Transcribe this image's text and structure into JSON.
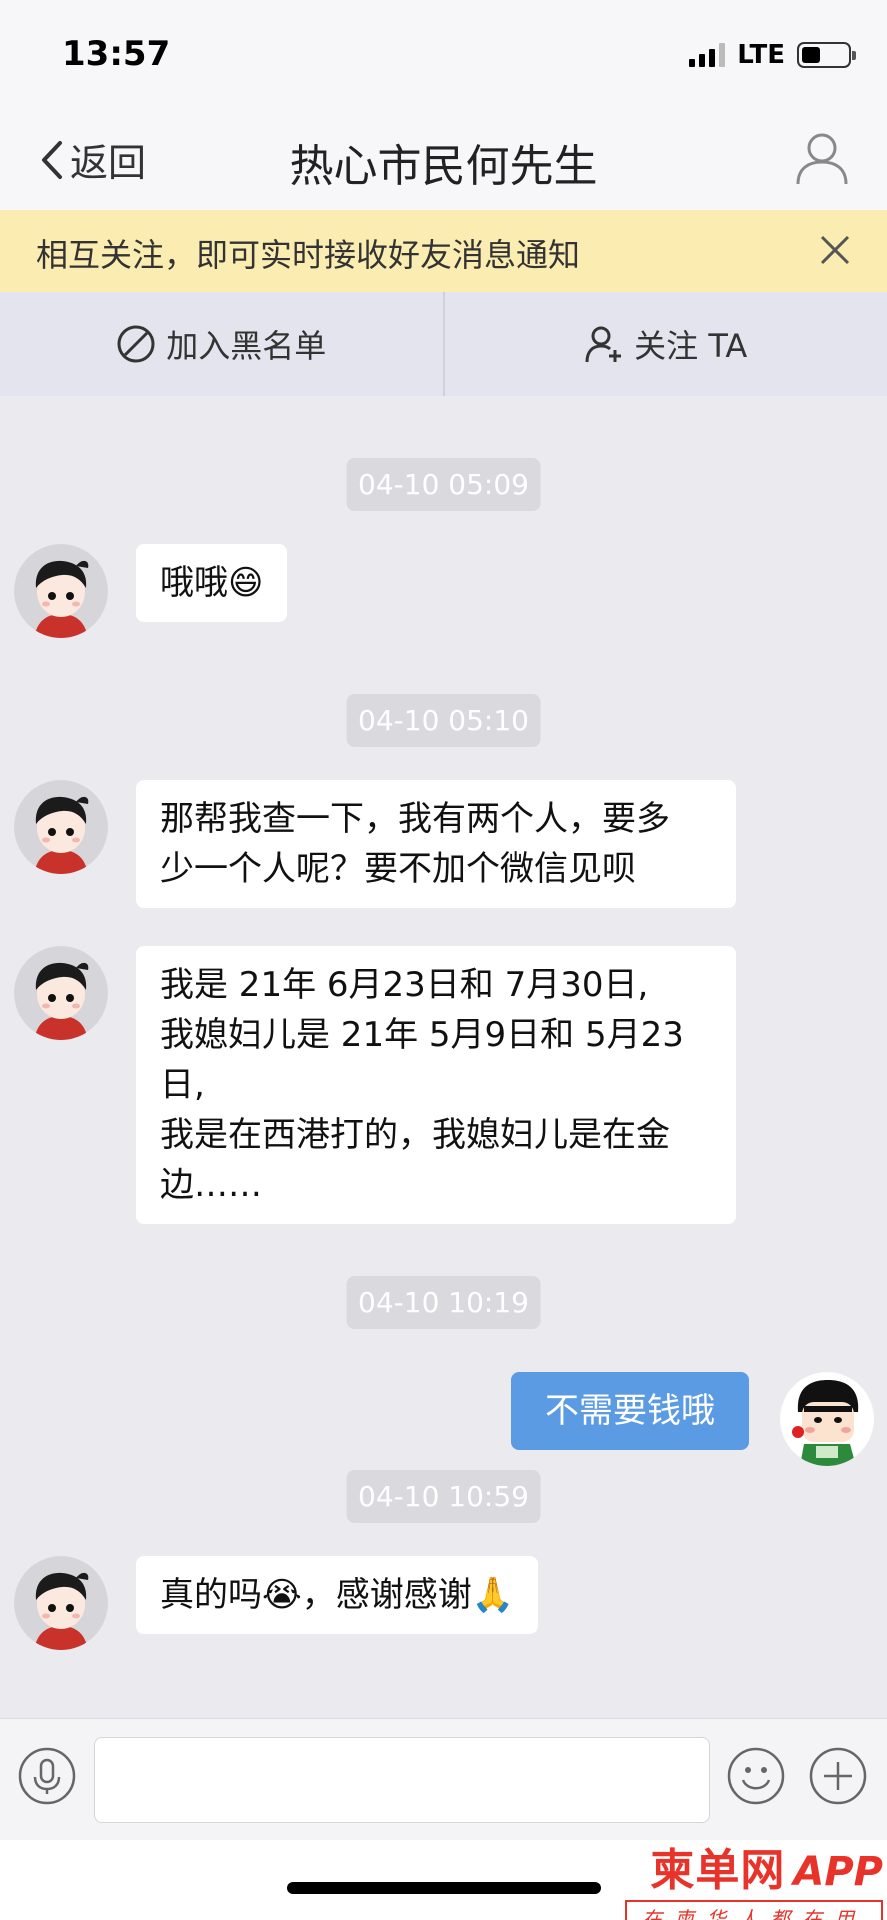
{
  "status_bar": {
    "time": "13:57",
    "network": "LTE"
  },
  "nav": {
    "back_label": "返回",
    "title": "热心市民何先生"
  },
  "notice": {
    "text": "相互关注，即可实时接收好友消息通知"
  },
  "actions": {
    "blacklist_label": "加入黑名单",
    "follow_label": "关注 TA"
  },
  "messages": {
    "ts1": "04-10 05:09",
    "m1": "哦哦😄",
    "ts2": "04-10 05:10",
    "m2_line1": "那帮我查一下，我有两个人，要多",
    "m2_line2": "少一个人呢？要不加个微信见呗",
    "m3_line1": "我是 21年 6月23日和 7月30日,",
    "m3_line2": "我媳妇儿是 21年 5月9日和 5月23",
    "m3_line3": "日,",
    "m3_line4": "我是在西港打的，我媳妇儿是在金",
    "m3_line5": "边……",
    "ts3": "04-10 10:19",
    "m4": "不需要钱哦",
    "ts4": "04-10 10:59",
    "m5": "真的吗😭，感谢感谢🙏"
  },
  "watermark": {
    "brand": "柬单网",
    "app": "APP",
    "slogan": "在柬华人都在用"
  },
  "colors": {
    "self_bubble": "#5b9be4",
    "notice_bg": "#fbedb1",
    "watermark_red": "#e8332a"
  }
}
